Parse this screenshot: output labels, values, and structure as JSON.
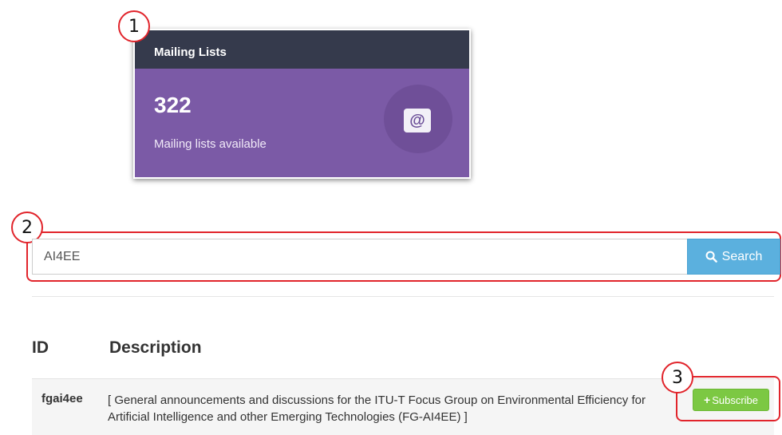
{
  "callouts": {
    "one": "1",
    "two": "2",
    "three": "3"
  },
  "stats_card": {
    "title": "Mailing Lists",
    "count": "322",
    "subtitle": "Mailing lists available",
    "icon": "at-sign-icon"
  },
  "search": {
    "value": "AI4EE",
    "button_label": "Search",
    "button_icon": "search-icon"
  },
  "table": {
    "headers": {
      "id": "ID",
      "description": "Description"
    },
    "rows": [
      {
        "id": "fgai4ee",
        "description": "[ General announcements and discussions for the ITU-T Focus Group on Environmental Efficiency for Artificial Intelligence and other Emerging Technologies (FG-AI4EE) ]",
        "action_label": "Subscribe",
        "action_icon": "plus-icon"
      }
    ]
  },
  "colors": {
    "annotation": "#e1242b",
    "card_header": "#353a4c",
    "card_body": "#7b5aa6",
    "search_button": "#5bb0de",
    "subscribe_button": "#7cc843"
  }
}
